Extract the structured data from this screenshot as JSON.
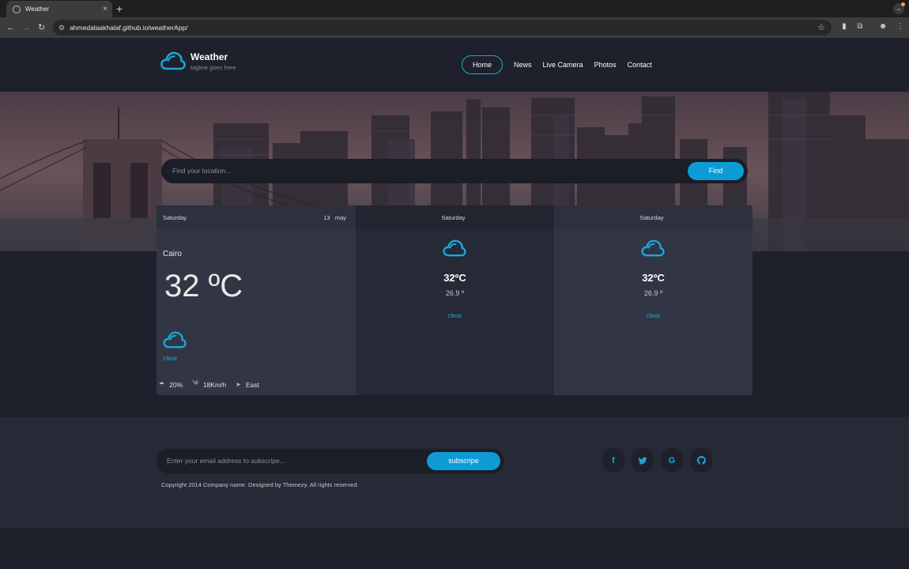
{
  "browser": {
    "tab_title": "Weather",
    "tab_close": "×",
    "new_tab": "+",
    "url": "ahmedalaakhalaf.github.io/weatherApp/"
  },
  "header": {
    "brand": "Weather",
    "tagline": "tagline goes here",
    "nav": [
      "Home",
      "News",
      "Live Camera",
      "Photos",
      "Contact"
    ],
    "active_nav": "Home"
  },
  "search": {
    "placeholder": "Find your location...",
    "button": "Find"
  },
  "forecast": {
    "today": {
      "day": "Saturday",
      "date_day": "13",
      "date_month": "may",
      "location": "Cairo",
      "temp": "32 ºC",
      "condition": "clear",
      "humidity": "20%",
      "wind": "18Km/h",
      "direction": "East"
    },
    "days": [
      {
        "day": "Saturday",
        "max": "32ºC",
        "min": "26.9 º",
        "condition": "clear"
      },
      {
        "day": "Saturday",
        "max": "32ºC",
        "min": "26.9 º",
        "condition": "clear"
      }
    ]
  },
  "footer": {
    "subscribe_placeholder": "Enter your email address to subscripe...",
    "subscribe_button": "subscripe",
    "copyright": "Copyright 2014 Company name. Designed by Themezy. All rights reserved",
    "social": [
      "facebook-icon",
      "twitter-icon",
      "google-icon",
      "github-icon"
    ]
  },
  "colors": {
    "accent": "#0d9bd6",
    "background": "#1e202b",
    "card": "#323544"
  }
}
